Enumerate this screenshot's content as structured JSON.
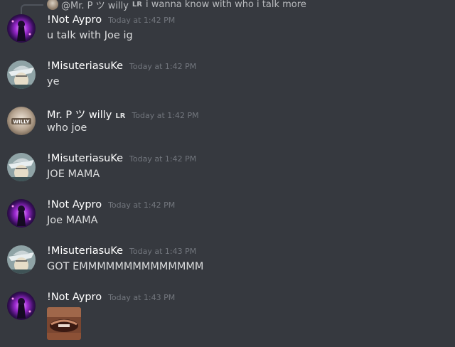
{
  "reply": {
    "author": "@Mr. P ツ willy",
    "tag": "LR",
    "text": "i wanna know with who i talk more"
  },
  "messages": [
    {
      "author": "!Not Aypro",
      "tag": "",
      "time": "Today at 1:42 PM",
      "text": "u talk with Joe ig",
      "avatar": "galaxy-avatar"
    },
    {
      "author": "!MisuteriasuKe",
      "tag": "",
      "time": "Today at 1:42 PM",
      "text": "ye",
      "avatar": "anime-hat-avatar"
    },
    {
      "author": "Mr. P ツ willy",
      "tag": "LR",
      "time": "Today at 1:42 PM",
      "text": "who joe",
      "avatar": "willy-avatar",
      "avatar_label": "WILLY"
    },
    {
      "author": "!MisuteriasuKe",
      "tag": "",
      "time": "Today at 1:42 PM",
      "text": "JOE MAMA",
      "avatar": "anime-hat-avatar"
    },
    {
      "author": "!Not Aypro",
      "tag": "",
      "time": "Today at 1:42 PM",
      "text": "Joe MAMA",
      "avatar": "galaxy-avatar"
    },
    {
      "author": "!MisuteriasuKe",
      "tag": "",
      "time": "Today at 1:43 PM",
      "text": "GOT EMMMMMMMMMMMMMM",
      "avatar": "anime-hat-avatar"
    },
    {
      "author": "!Not Aypro",
      "tag": "",
      "time": "Today at 1:43 PM",
      "text": "",
      "avatar": "galaxy-avatar",
      "attachment": "image-attachment"
    }
  ]
}
